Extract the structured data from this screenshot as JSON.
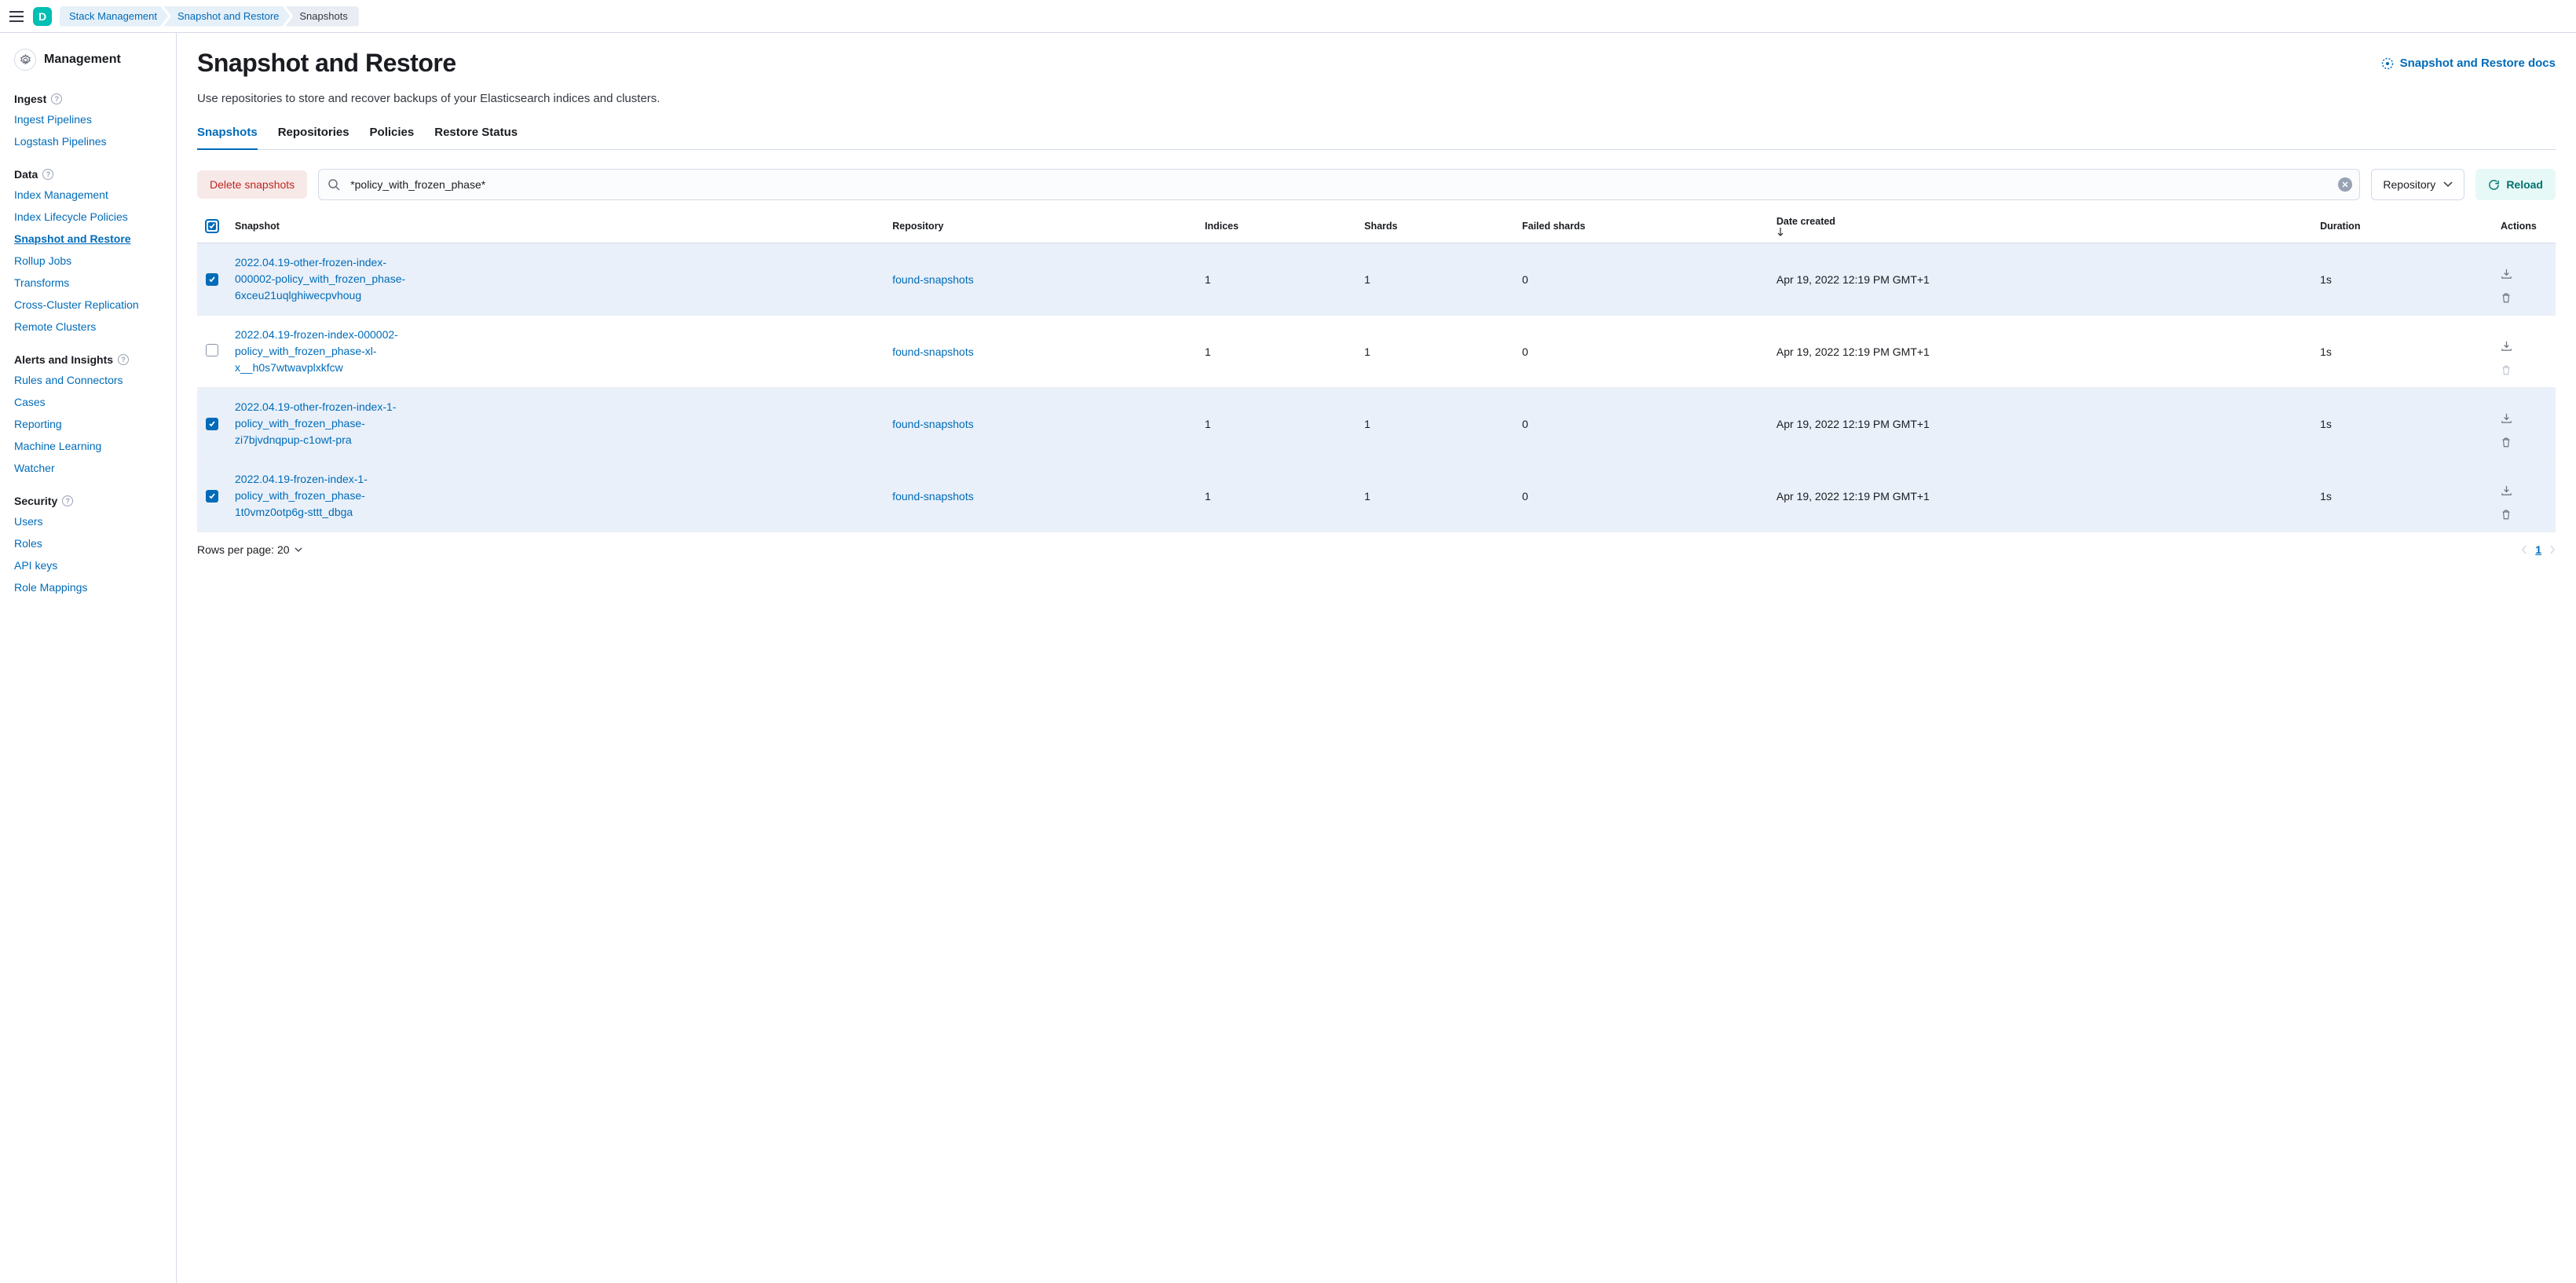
{
  "header": {
    "space_initial": "D",
    "breadcrumbs": [
      "Stack Management",
      "Snapshot and Restore",
      "Snapshots"
    ]
  },
  "sidebar": {
    "title": "Management",
    "groups": [
      {
        "label": "Ingest",
        "items": [
          {
            "label": "Ingest Pipelines",
            "active": false
          },
          {
            "label": "Logstash Pipelines",
            "active": false
          }
        ]
      },
      {
        "label": "Data",
        "items": [
          {
            "label": "Index Management",
            "active": false
          },
          {
            "label": "Index Lifecycle Policies",
            "active": false
          },
          {
            "label": "Snapshot and Restore",
            "active": true
          },
          {
            "label": "Rollup Jobs",
            "active": false
          },
          {
            "label": "Transforms",
            "active": false
          },
          {
            "label": "Cross-Cluster Replication",
            "active": false
          },
          {
            "label": "Remote Clusters",
            "active": false
          }
        ]
      },
      {
        "label": "Alerts and Insights",
        "items": [
          {
            "label": "Rules and Connectors",
            "active": false
          },
          {
            "label": "Cases",
            "active": false
          },
          {
            "label": "Reporting",
            "active": false
          },
          {
            "label": "Machine Learning",
            "active": false
          },
          {
            "label": "Watcher",
            "active": false
          }
        ]
      },
      {
        "label": "Security",
        "items": [
          {
            "label": "Users",
            "active": false
          },
          {
            "label": "Roles",
            "active": false
          },
          {
            "label": "API keys",
            "active": false
          },
          {
            "label": "Role Mappings",
            "active": false
          }
        ]
      }
    ]
  },
  "page": {
    "title": "Snapshot and Restore",
    "subtitle": "Use repositories to store and recover backups of your Elasticsearch indices and clusters.",
    "docs_link": "Snapshot and Restore docs"
  },
  "tabs": [
    {
      "label": "Snapshots",
      "active": true
    },
    {
      "label": "Repositories",
      "active": false
    },
    {
      "label": "Policies",
      "active": false
    },
    {
      "label": "Restore Status",
      "active": false
    }
  ],
  "toolbar": {
    "delete_label": "Delete snapshots",
    "search_value": "*policy_with_frozen_phase*",
    "repo_filter_label": "Repository",
    "reload_label": "Reload"
  },
  "table": {
    "columns": {
      "snapshot": "Snapshot",
      "repository": "Repository",
      "indices": "Indices",
      "shards": "Shards",
      "failed_shards": "Failed shards",
      "date_created": "Date created",
      "duration": "Duration",
      "actions": "Actions"
    },
    "rows": [
      {
        "selected": true,
        "name": "2022.04.19-other-frozen-index-000002-policy_with_frozen_phase-6xceu21uqlghiwecpvhoug",
        "repository": "found-snapshots",
        "indices": "1",
        "shards": "1",
        "failed_shards": "0",
        "date_created": "Apr 19, 2022 12:19 PM GMT+1",
        "duration": "1s"
      },
      {
        "selected": false,
        "name": "2022.04.19-frozen-index-000002-policy_with_frozen_phase-xl-x__h0s7wtwavplxkfcw",
        "repository": "found-snapshots",
        "indices": "1",
        "shards": "1",
        "failed_shards": "0",
        "date_created": "Apr 19, 2022 12:19 PM GMT+1",
        "duration": "1s"
      },
      {
        "selected": true,
        "name": "2022.04.19-other-frozen-index-1-policy_with_frozen_phase-zi7bjvdnqpup-c1owt-pra",
        "repository": "found-snapshots",
        "indices": "1",
        "shards": "1",
        "failed_shards": "0",
        "date_created": "Apr 19, 2022 12:19 PM GMT+1",
        "duration": "1s"
      },
      {
        "selected": true,
        "name": "2022.04.19-frozen-index-1-policy_with_frozen_phase-1t0vmz0otp6g-sttt_dbga",
        "repository": "found-snapshots",
        "indices": "1",
        "shards": "1",
        "failed_shards": "0",
        "date_created": "Apr 19, 2022 12:19 PM GMT+1",
        "duration": "1s"
      }
    ]
  },
  "footer": {
    "rows_per_page_label": "Rows per page: 20",
    "current_page": "1"
  }
}
